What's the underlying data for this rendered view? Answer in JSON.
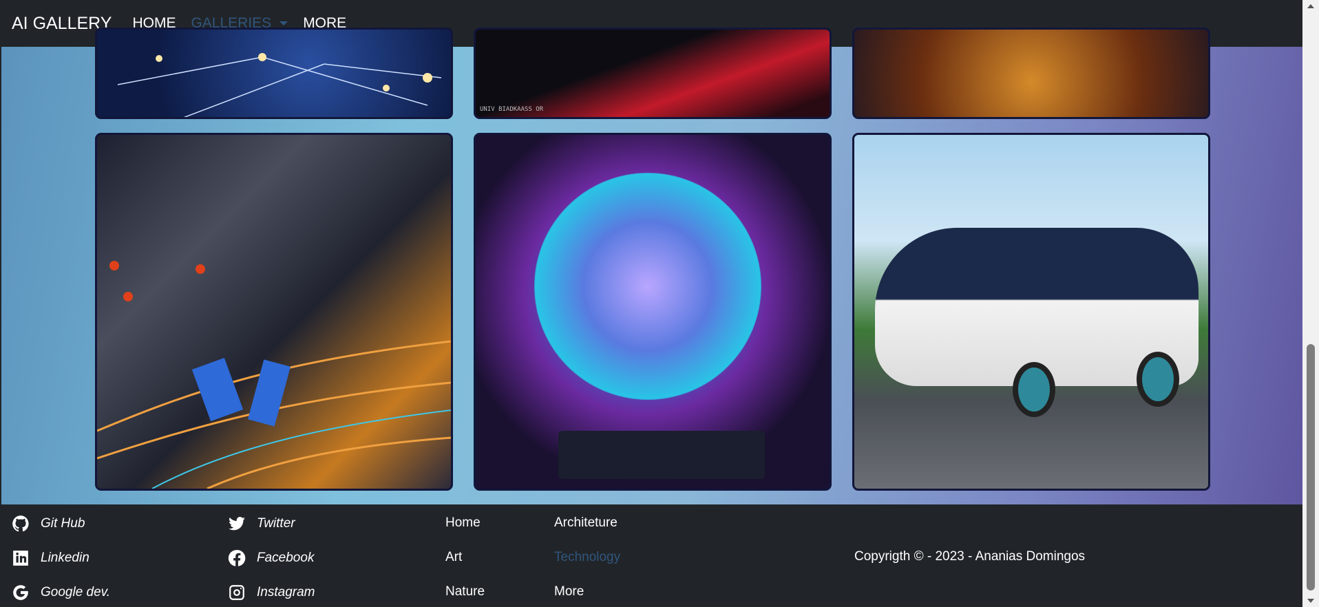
{
  "navbar": {
    "brand": "AI GALLERY",
    "links": [
      {
        "label": "HOME"
      },
      {
        "label": "GALLERIES"
      },
      {
        "label": "MORE"
      }
    ]
  },
  "gallery": {
    "images": [
      {
        "alt": "network lines"
      },
      {
        "alt": "red light trails"
      },
      {
        "alt": "golden circuit"
      },
      {
        "alt": "abstract machine wires"
      },
      {
        "alt": "glowing face orb"
      },
      {
        "alt": "white futuristic bus"
      }
    ],
    "watermark": "UNIV BIADKAASS OR"
  },
  "footer": {
    "social": [
      {
        "label": "Git Hub",
        "icon": "github-icon"
      },
      {
        "label": "Twitter",
        "icon": "twitter-icon"
      },
      {
        "label": "Linkedin",
        "icon": "linkedin-icon"
      },
      {
        "label": "Facebook",
        "icon": "facebook-icon"
      },
      {
        "label": "Google dev.",
        "icon": "google-icon"
      },
      {
        "label": "Instagram",
        "icon": "instagram-icon"
      }
    ],
    "nav": [
      "Home",
      "Art",
      "Nature"
    ],
    "categories": [
      "Architeture",
      "Technology",
      "More"
    ],
    "copyright": "Copyrigth © - 2023 - Ananias Domingos"
  },
  "colors": {
    "navbar_bg": "#212529",
    "muted_link": "#31557c",
    "card_border": "#12163a"
  }
}
